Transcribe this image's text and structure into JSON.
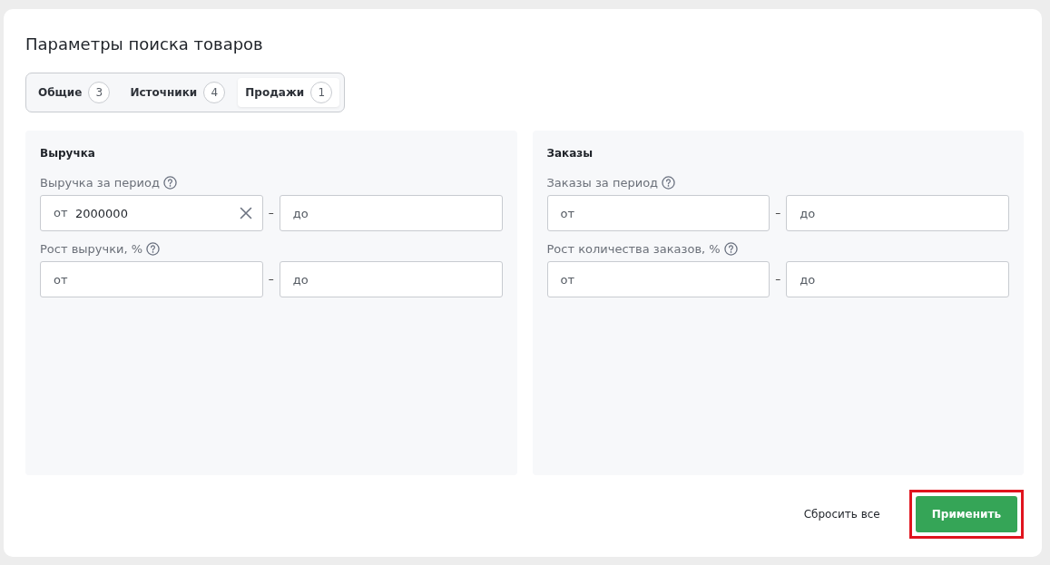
{
  "title": "Параметры поиска товаров",
  "tabs": [
    {
      "label": "Общие",
      "count": "3",
      "selected": false
    },
    {
      "label": "Источники",
      "count": "4",
      "selected": false
    },
    {
      "label": "Продажи",
      "count": "1",
      "selected": true
    }
  ],
  "panels": [
    {
      "heading": "Выручка",
      "filters": [
        {
          "label": "Выручка за период",
          "from": {
            "prefix": "от",
            "value": "2000000"
          },
          "to": {
            "placeholder": "до"
          }
        },
        {
          "label": "Рост выручки, %",
          "from": {
            "placeholder": "от"
          },
          "to": {
            "placeholder": "до"
          }
        }
      ]
    },
    {
      "heading": "Заказы",
      "filters": [
        {
          "label": "Заказы за период",
          "from": {
            "placeholder": "от"
          },
          "to": {
            "placeholder": "до"
          }
        },
        {
          "label": "Рост количества заказов, %",
          "from": {
            "placeholder": "от"
          },
          "to": {
            "placeholder": "до"
          }
        }
      ]
    }
  ],
  "range_separator": "–",
  "reset_button": "Сбросить все",
  "apply_button": {
    "label": "Применить",
    "highlighted": true
  }
}
